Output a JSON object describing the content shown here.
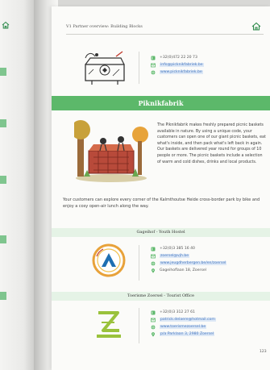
{
  "header": {
    "title": "V1 Partner overview: Building Blocks"
  },
  "top_contact": {
    "items": [
      {
        "icon": "phone-icon",
        "text": "+32(0)472 22 20 73"
      },
      {
        "icon": "email-icon",
        "text": "info@picknikfabriek.be"
      },
      {
        "icon": "website-icon",
        "text": "www.picknikfabriek.be"
      }
    ]
  },
  "piknikfabrik": {
    "title": "Piknikfabrik",
    "description": "The Piknikfabrik makes freshly prepared picnic baskets available in nature. By using a unique code, your customers can open one of our giant picnic baskets, eat what's inside, and then pack what's left back in again. Our baskets are delivered year round for groups of 10 people or more. The picnic baskets include a selection of warm and cold dishes, drinks and local products.",
    "body": "Your customers can explore every corner of the Kalmthoutse Heide cross-border park by bike and enjoy a cosy open-air lunch along the way."
  },
  "gageihof": {
    "title": "Gageihof - Youth Hostel",
    "items": [
      {
        "icon": "phone-icon",
        "text": "+32(0)3 385 16 40"
      },
      {
        "icon": "email-icon",
        "text": "zoersel@vjh.be"
      },
      {
        "icon": "website-icon",
        "text": "www.jeugdherbergen.be/en/zoersel"
      },
      {
        "icon": "location-icon",
        "text": "Gageihoflaan 18, Zoersel"
      }
    ]
  },
  "toerisme": {
    "title": "Toerisme Zoersel - Tourist Office",
    "items": [
      {
        "icon": "phone-icon",
        "text": "+32(0)3 312 27 61"
      },
      {
        "icon": "email-icon",
        "text": "patrick.delaere@hotmail.com"
      },
      {
        "icon": "website-icon",
        "text": "www.toerismezoersel.be"
      },
      {
        "icon": "location-icon",
        "text": "p/a Parklaan 3, 2980 Zoersel"
      }
    ]
  },
  "page_number": "123",
  "colors": {
    "accent_green": "#5cb86a",
    "light_green_band": "#e5f3e6",
    "link_blue": "#4a7ac0"
  }
}
